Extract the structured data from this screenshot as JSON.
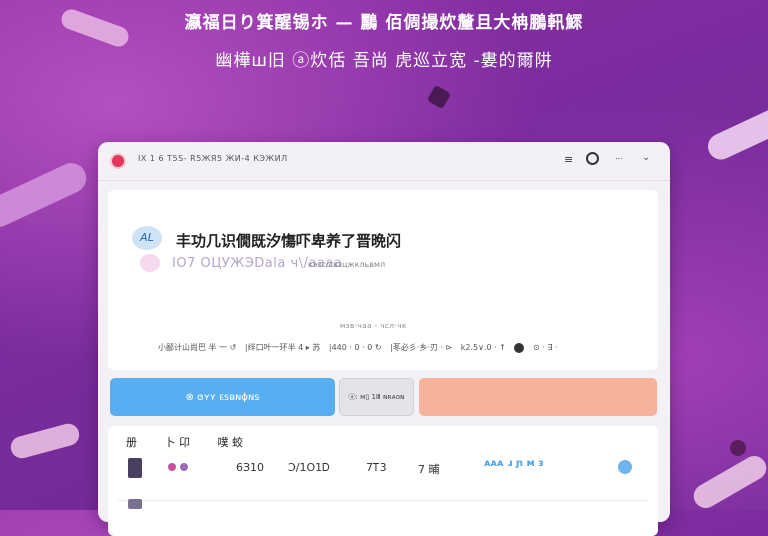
{
  "headline": {
    "line1": "瀛福日り箕醒锡ホ — 鸝 佰倜撮炊釐且大柟鵬軐鰥",
    "line2": "幽樺ш旧 ⓐ炊佸 吾尚 虎巡立宽 -婁的爾阱"
  },
  "topbar": {
    "title": "IX  1 6  T5S-  R5ЖЯ5  ЖИ-4  КЭЖИЛ",
    "icons": [
      "menu-lines-icon",
      "globe-icon",
      "more-icon",
      "chevron-icon"
    ],
    "menu_glyph": "≡",
    "globe_glyph": "",
    "more_text": "⋯",
    "chevron_text": "⌄"
  },
  "panel": {
    "bubble_text": "AL",
    "title": "丰功几识僩既汐慯吓卑养了晋晩闪",
    "subtitle": "IO7 ОЦУЖЭDаlа ч\\/аааа",
    "subtitle_note": "кэзс/свзцжкльвмл",
    "mid_caption": "мзв-чаа - чсл-чк",
    "stats": [
      "小鄙计山尚巴 半 一 ↺",
      "|绊口叶一环半 4 ▸ 苏",
      "|440  ·  0 · 0 ↻",
      "|苳必彡·乡·刃  ·  ⊳",
      "k2.5∨.0 · ↑",
      "⊙ · ∃ ·"
    ]
  },
  "buttons": {
    "blue_label": "⊗  ɞʏʏ ᴇsʙɴɸɴꜱ",
    "gray_label": "ⓐ: ᴍ▯ 1Ⅲ  ɴʀᴀᴏɴ",
    "peach_label": ""
  },
  "list": {
    "headers": [
      "册",
      "卜 卬",
      "噗 蛟"
    ],
    "row": {
      "col1": "",
      "col2": "6З10",
      "col3": "Ͻ/1О1Ꭰ",
      "col4": "7Ꭲ3",
      "col5": "7  晡",
      "wave_text": "ᴀᴀᴀ ɹ ɲ ᴍ ᴈ",
      "status_icon": "status-dot-icon"
    }
  },
  "colors": {
    "background": "#7b2c9e",
    "primary_button": "#58aef0",
    "peach_button": "#f7b29b",
    "logo": "#e0375a"
  }
}
